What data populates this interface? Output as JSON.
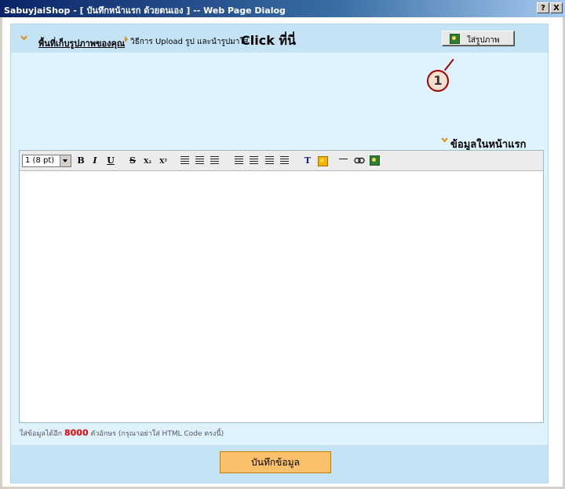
{
  "window": {
    "title": "SabuyjaiShop - [ บันทึกหน้าแรก ด้วยตนเอง ] -- Web Page Dialog",
    "help_label": "?",
    "close_label": "X"
  },
  "header": {
    "link_text": "พื้นที่เก็บรูปภาพของคุณ",
    "instruction": "วิธีการ Upload รูป และนำรูปมาใส่",
    "click_text": "Click ที่นี่",
    "insert_image_label": "ใส่รูปภาพ"
  },
  "callout": {
    "number": "1"
  },
  "section": {
    "front_page_label": "ข้อมูลในหน้าแรก"
  },
  "toolbar": {
    "font_size_value": "1 (8 pt)",
    "bold": "B",
    "italic": "I",
    "underline": "U",
    "strike": "S",
    "subscript": "X₂",
    "superscript": "X²",
    "text_color": "T"
  },
  "hint": {
    "prefix": "ใส่ข้อมูลได้อีก",
    "remaining": "8000",
    "suffix": "ตัวอักษร (กรุณาอย่าใส่ HTML Code ตรงนี้)"
  },
  "footer": {
    "save_label": "บันทึกข้อมูล"
  },
  "colors": {
    "accent": "#e08a00",
    "panel_bg": "#dff3ff",
    "band_bg": "#c4e4f6",
    "save_button_bg": "#fbc06a",
    "counter_red": "#e00000"
  }
}
